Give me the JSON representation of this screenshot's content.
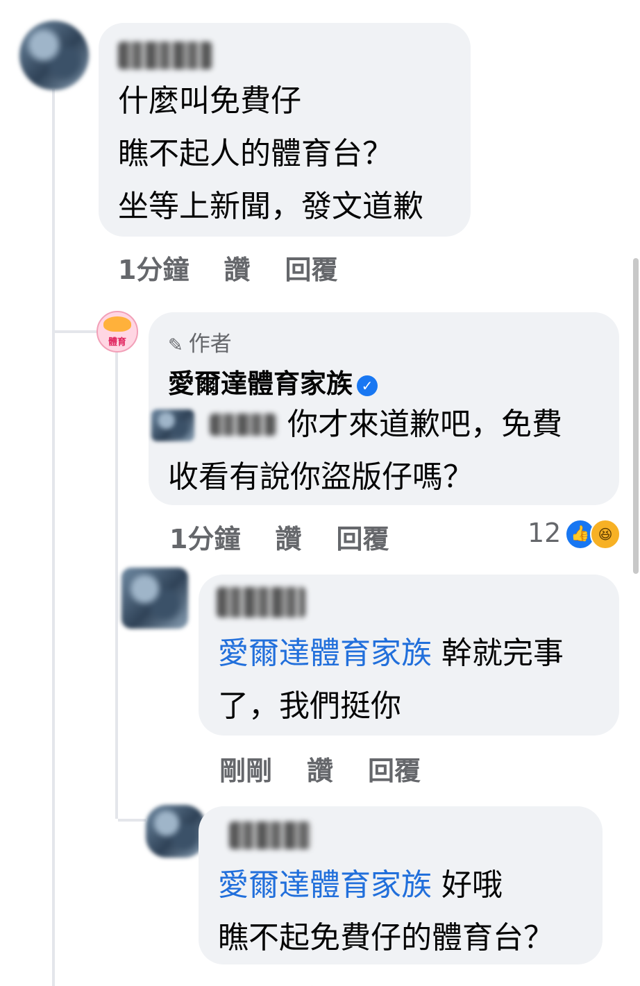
{
  "comments": [
    {
      "author_name": "",
      "lines": [
        "什麼叫免費仔",
        "瞧不起人的體育台？",
        "坐等上新聞，發文道歉"
      ],
      "time": "1分鐘",
      "like": "讚",
      "reply": "回覆"
    },
    {
      "author_tag": "作者",
      "author_name": "愛爾達體育家族",
      "lines": [
        "你才來道歉吧，免費",
        "收看有說你盜版仔嗎？"
      ],
      "time": "1分鐘",
      "like": "讚",
      "reply": "回覆",
      "reaction_count": "12",
      "reactions": [
        "like-icon",
        "haha-icon"
      ],
      "avatar_label": "體育"
    },
    {
      "author_name": "",
      "mention": "愛爾達體育家族",
      "line1_rest": " 幹就完事",
      "line2": "了，我們挺你",
      "time": "剛剛",
      "like": "讚",
      "reply": "回覆"
    },
    {
      "author_name": "",
      "mention": "愛爾達體育家族",
      "line1_rest": " 好哦",
      "line2": "瞧不起免費仔的體育台？",
      "time": "剛剛",
      "like": "讚",
      "reply": "回覆"
    }
  ],
  "colors": {
    "bubble": "#f0f2f5",
    "mention": "#216fdb",
    "meta": "#65676b",
    "verified": "#1877f2"
  }
}
